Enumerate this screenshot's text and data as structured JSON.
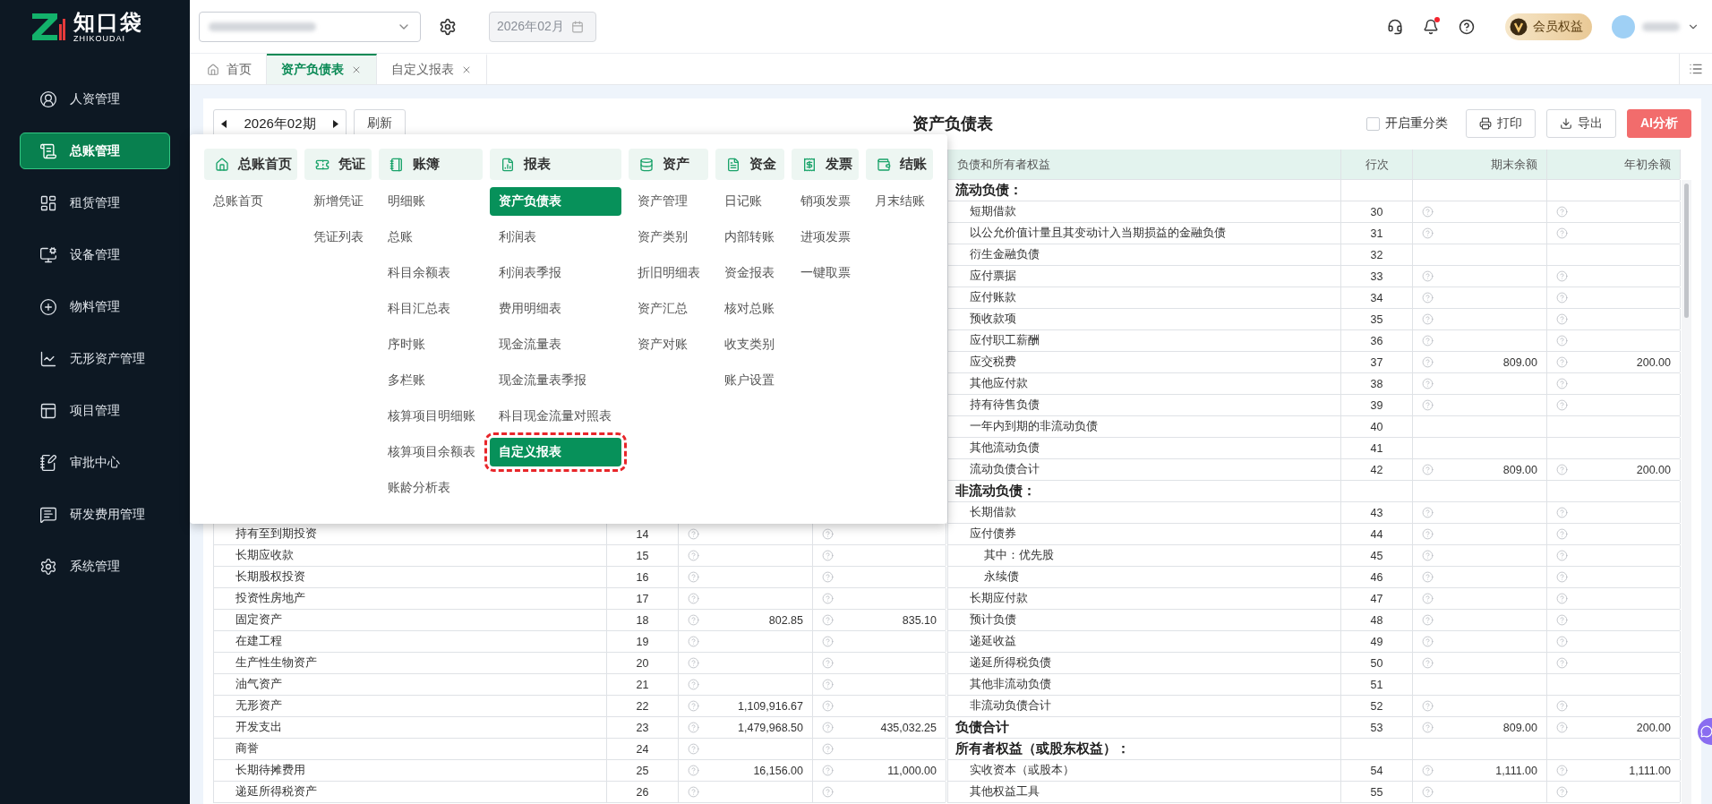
{
  "sidebar": {
    "logo": {
      "name": "知口袋",
      "subtitle": "ZHIKOUDAI"
    },
    "items": [
      {
        "label": "人资管理",
        "selected": false
      },
      {
        "label": "总账管理",
        "selected": true
      },
      {
        "label": "租赁管理",
        "selected": false
      },
      {
        "label": "设备管理",
        "selected": false
      },
      {
        "label": "物料管理",
        "selected": false
      },
      {
        "label": "无形资产管理",
        "selected": false
      },
      {
        "label": "项目管理",
        "selected": false
      },
      {
        "label": "审批中心",
        "selected": false
      },
      {
        "label": "研发费用管理",
        "selected": false
      },
      {
        "label": "系统管理",
        "selected": false
      }
    ]
  },
  "topbar": {
    "date_field": {
      "value": "2026年02月",
      "disabled": true
    },
    "notifications": {
      "unread": true
    },
    "vip_badge": {
      "label": "会员权益"
    }
  },
  "tabs": [
    {
      "label": "首页",
      "selected": false,
      "closable": false
    },
    {
      "label": "资产负债表",
      "selected": true,
      "closable": true
    },
    {
      "label": "自定义报表",
      "selected": false,
      "closable": true
    }
  ],
  "toolbar": {
    "period": "2026年02期",
    "refresh": "刷新",
    "title": "资产负债表",
    "reclassify": {
      "label": "开启重分类",
      "checked": false
    },
    "buttons": [
      {
        "label": "打印",
        "kind": "print"
      },
      {
        "label": "导出",
        "kind": "export"
      },
      {
        "label": "AI分析",
        "kind": "ai"
      }
    ]
  },
  "menu": {
    "groups": [
      {
        "title": "总账首页",
        "items": [
          {
            "label": "总账首页",
            "selected": false,
            "annotated": false
          }
        ]
      },
      {
        "title": "凭证",
        "items": [
          {
            "label": "新增凭证",
            "selected": false,
            "annotated": false
          },
          {
            "label": "凭证列表",
            "selected": false,
            "annotated": false
          }
        ]
      },
      {
        "title": "账簿",
        "items": [
          {
            "label": "明细账",
            "selected": false,
            "annotated": false
          },
          {
            "label": "总账",
            "selected": false,
            "annotated": false
          },
          {
            "label": "科目余额表",
            "selected": false,
            "annotated": false
          },
          {
            "label": "科目汇总表",
            "selected": false,
            "annotated": false
          },
          {
            "label": "序时账",
            "selected": false,
            "annotated": false
          },
          {
            "label": "多栏账",
            "selected": false,
            "annotated": false
          },
          {
            "label": "核算项目明细账",
            "selected": false,
            "annotated": false
          },
          {
            "label": "核算项目余额表",
            "selected": false,
            "annotated": false
          },
          {
            "label": "账龄分析表",
            "selected": false,
            "annotated": false
          }
        ]
      },
      {
        "title": "报表",
        "items": [
          {
            "label": "资产负债表",
            "selected": true,
            "annotated": false
          },
          {
            "label": "利润表",
            "selected": false,
            "annotated": false
          },
          {
            "label": "利润表季报",
            "selected": false,
            "annotated": false
          },
          {
            "label": "费用明细表",
            "selected": false,
            "annotated": false
          },
          {
            "label": "现金流量表",
            "selected": false,
            "annotated": false
          },
          {
            "label": "现金流量表季报",
            "selected": false,
            "annotated": false
          },
          {
            "label": "科目现金流量对照表",
            "selected": false,
            "annotated": false
          },
          {
            "label": "自定义报表",
            "selected": true,
            "annotated": true
          }
        ]
      },
      {
        "title": "资产",
        "items": [
          {
            "label": "资产管理",
            "selected": false,
            "annotated": false
          },
          {
            "label": "资产类别",
            "selected": false,
            "annotated": false
          },
          {
            "label": "折旧明细表",
            "selected": false,
            "annotated": false
          },
          {
            "label": "资产汇总",
            "selected": false,
            "annotated": false
          },
          {
            "label": "资产对账",
            "selected": false,
            "annotated": false
          }
        ]
      },
      {
        "title": "资金",
        "items": [
          {
            "label": "日记账",
            "selected": false,
            "annotated": false
          },
          {
            "label": "内部转账",
            "selected": false,
            "annotated": false
          },
          {
            "label": "资金报表",
            "selected": false,
            "annotated": false
          },
          {
            "label": "核对总账",
            "selected": false,
            "annotated": false
          },
          {
            "label": "收支类别",
            "selected": false,
            "annotated": false
          },
          {
            "label": "账户设置",
            "selected": false,
            "annotated": false
          }
        ]
      },
      {
        "title": "发票",
        "items": [
          {
            "label": "销项发票",
            "selected": false,
            "annotated": false
          },
          {
            "label": "进项发票",
            "selected": false,
            "annotated": false
          },
          {
            "label": "一键取票",
            "selected": false,
            "annotated": false
          }
        ]
      },
      {
        "title": "结账",
        "items": [
          {
            "label": "月末结账",
            "selected": false,
            "annotated": false
          }
        ]
      }
    ]
  },
  "table": {
    "liabilities_columns": [
      "负债和所有者权益",
      "行次",
      "期末余额",
      "年初余额"
    ],
    "assets_rows": [
      {
        "name": "持有至到期投资",
        "line": "14",
        "hint": true
      },
      {
        "name": "长期应收款",
        "line": "15",
        "hint": true
      },
      {
        "name": "长期股权投资",
        "line": "16",
        "hint": true
      },
      {
        "name": "投资性房地产",
        "line": "17",
        "hint": true
      },
      {
        "name": "固定资产",
        "line": "18",
        "hint": true,
        "end": "802.85",
        "start": "835.10"
      },
      {
        "name": "在建工程",
        "line": "19",
        "hint": true
      },
      {
        "name": "生产性生物资产",
        "line": "20",
        "hint": true
      },
      {
        "name": "油气资产",
        "line": "21",
        "hint": true
      },
      {
        "name": "无形资产",
        "line": "22",
        "hint": true,
        "end": "1,109,916.67"
      },
      {
        "name": "开发支出",
        "line": "23",
        "hint": true,
        "end": "1,479,968.50",
        "start": "435,032.25"
      },
      {
        "name": "商誉",
        "line": "24",
        "hint": true
      },
      {
        "name": "长期待摊费用",
        "line": "25",
        "hint": true,
        "end": "16,156.00",
        "start": "11,000.00"
      },
      {
        "name": "递延所得税资产",
        "line": "26",
        "hint": true
      }
    ],
    "liabilities_rows": [
      {
        "name": "流动负债：",
        "hint": false,
        "children": [
          {
            "name": "短期借款",
            "line": "30",
            "hint": true
          },
          {
            "name": "以公允价值计量且其变动计入当期损益的金融负债",
            "line": "31",
            "hint": true
          },
          {
            "name": "衍生金融负债",
            "line": "32",
            "hint": false
          },
          {
            "name": "应付票据",
            "line": "33",
            "hint": true
          },
          {
            "name": "应付账款",
            "line": "34",
            "hint": true
          },
          {
            "name": "预收款项",
            "line": "35",
            "hint": true
          },
          {
            "name": "应付职工薪酬",
            "line": "36",
            "hint": true
          },
          {
            "name": "应交税费",
            "line": "37",
            "hint": true,
            "end": "809.00",
            "start": "200.00"
          },
          {
            "name": "其他应付款",
            "line": "38",
            "hint": true
          },
          {
            "name": "持有待售负债",
            "line": "39",
            "hint": true
          },
          {
            "name": "一年内到期的非流动负债",
            "line": "40",
            "hint": false
          },
          {
            "name": "其他流动负债",
            "line": "41",
            "hint": false
          },
          {
            "name": "流动负债合计",
            "line": "42",
            "hint": true,
            "end": "809.00",
            "start": "200.00"
          }
        ]
      },
      {
        "name": "非流动负债：",
        "hint": false,
        "children": [
          {
            "name": "长期借款",
            "line": "43",
            "hint": true
          },
          {
            "name": "应付债券",
            "line": "44",
            "hint": true,
            "children": [
              {
                "name": "其中：优先股",
                "line": "45",
                "hint": true
              },
              {
                "name": "永续债",
                "line": "46",
                "hint": true
              }
            ]
          },
          {
            "name": "长期应付款",
            "line": "47",
            "hint": true
          },
          {
            "name": "预计负债",
            "line": "48",
            "hint": true
          },
          {
            "name": "递延收益",
            "line": "49",
            "hint": true
          },
          {
            "name": "递延所得税负债",
            "line": "50",
            "hint": true
          },
          {
            "name": "其他非流动负债",
            "line": "51",
            "hint": false
          },
          {
            "name": "非流动负债合计",
            "line": "52",
            "hint": true
          }
        ]
      },
      {
        "name": "负债合计",
        "line": "53",
        "hint": true,
        "end": "809.00",
        "start": "200.00"
      },
      {
        "name": "所有者权益（或股东权益）：",
        "hint": false,
        "children": [
          {
            "name": "实收资本（或股本）",
            "line": "54",
            "hint": true,
            "end": "1,111.00",
            "start": "1,111.00"
          },
          {
            "name": "其他权益工具",
            "line": "55",
            "hint": true
          }
        ]
      }
    ]
  }
}
